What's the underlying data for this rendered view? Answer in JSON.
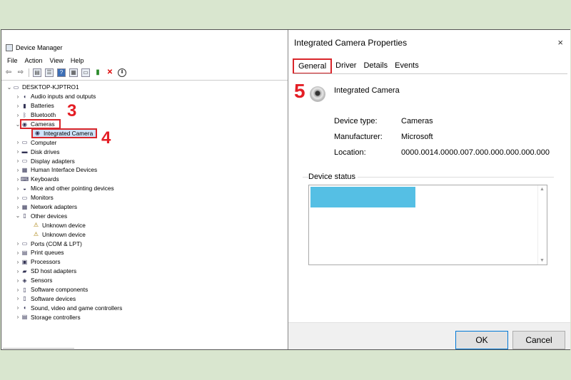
{
  "device_manager": {
    "title": "Device Manager",
    "menu": [
      "File",
      "Action",
      "View",
      "Help"
    ],
    "toolbar_icons": [
      "back-arrow-icon",
      "forward-arrow-icon",
      "properties-icon",
      "list-icon",
      "help-icon",
      "scan-icon",
      "monitor-icon",
      "add-driver-icon",
      "remove-device-icon",
      "download-icon"
    ],
    "tree": [
      {
        "label": "DESKTOP-KJPTRO1",
        "level": 0,
        "expand": "v",
        "icon": "computer-icon"
      },
      {
        "label": "Audio inputs and outputs",
        "level": 1,
        "expand": ">",
        "icon": "speaker-icon"
      },
      {
        "label": "Batteries",
        "level": 1,
        "expand": ">",
        "icon": "battery-icon"
      },
      {
        "label": "Bluetooth",
        "level": 1,
        "expand": ">",
        "icon": "bluetooth-icon"
      },
      {
        "label": "Cameras",
        "level": 1,
        "expand": "v",
        "icon": "camera-icon",
        "highlight": "cameras"
      },
      {
        "label": "Integrated Camera",
        "level": 2,
        "expand": "",
        "icon": "camera-icon",
        "highlight": "integrated"
      },
      {
        "label": "Computer",
        "level": 1,
        "expand": ">",
        "icon": "computer-icon"
      },
      {
        "label": "Disk drives",
        "level": 1,
        "expand": ">",
        "icon": "disk-icon"
      },
      {
        "label": "Display adapters",
        "level": 1,
        "expand": ">",
        "icon": "display-icon"
      },
      {
        "label": "Human Interface Devices",
        "level": 1,
        "expand": ">",
        "icon": "hid-icon"
      },
      {
        "label": "Keyboards",
        "level": 1,
        "expand": ">",
        "icon": "keyboard-icon"
      },
      {
        "label": "Mice and other pointing devices",
        "level": 1,
        "expand": ">",
        "icon": "mouse-icon"
      },
      {
        "label": "Monitors",
        "level": 1,
        "expand": ">",
        "icon": "monitor-icon"
      },
      {
        "label": "Network adapters",
        "level": 1,
        "expand": ">",
        "icon": "network-icon"
      },
      {
        "label": "Other devices",
        "level": 1,
        "expand": "v",
        "icon": "other-devices-icon"
      },
      {
        "label": "Unknown device",
        "level": 2,
        "expand": "",
        "icon": "warning-icon"
      },
      {
        "label": "Unknown device",
        "level": 2,
        "expand": "",
        "icon": "warning-icon"
      },
      {
        "label": "Ports (COM & LPT)",
        "level": 1,
        "expand": ">",
        "icon": "port-icon"
      },
      {
        "label": "Print queues",
        "level": 1,
        "expand": ">",
        "icon": "printer-icon"
      },
      {
        "label": "Processors",
        "level": 1,
        "expand": ">",
        "icon": "cpu-icon"
      },
      {
        "label": "SD host adapters",
        "level": 1,
        "expand": ">",
        "icon": "sd-card-icon"
      },
      {
        "label": "Sensors",
        "level": 1,
        "expand": ">",
        "icon": "sensor-icon"
      },
      {
        "label": "Software components",
        "level": 1,
        "expand": ">",
        "icon": "software-icon"
      },
      {
        "label": "Software devices",
        "level": 1,
        "expand": ">",
        "icon": "software-icon"
      },
      {
        "label": "Sound, video and game controllers",
        "level": 1,
        "expand": ">",
        "icon": "sound-icon"
      },
      {
        "label": "Storage controllers",
        "level": 1,
        "expand": ">",
        "icon": "storage-icon"
      }
    ]
  },
  "annotations": {
    "step3": "3",
    "step4": "4",
    "step5": "5"
  },
  "properties": {
    "title": "Integrated Camera Properties",
    "close": "×",
    "tabs": [
      "General",
      "Driver",
      "Details",
      "Events"
    ],
    "active_tab": "General",
    "device_name": "Integrated Camera",
    "rows": [
      {
        "key": "Device type:",
        "value": "Cameras"
      },
      {
        "key": "Manufacturer:",
        "value": "Microsoft"
      },
      {
        "key": "Location:",
        "value": "0000.0014.0000.007.000.000.000.000.000"
      }
    ],
    "status_label": "Device status",
    "ok": "OK",
    "cancel": "Cancel"
  },
  "colors": {
    "annotation": "#e41e25",
    "selection": "#55bfe4",
    "background": "#d9e6cf"
  }
}
